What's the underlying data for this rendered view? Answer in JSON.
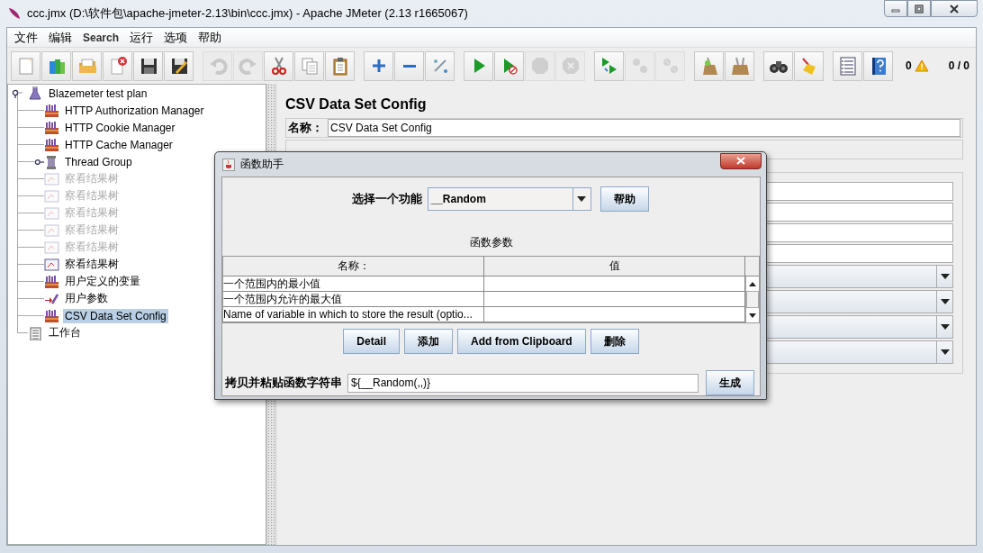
{
  "window": {
    "title": "ccc.jmx (D:\\软件包\\apache-jmeter-2.13\\bin\\ccc.jmx) - Apache JMeter (2.13 r1665067)"
  },
  "menu": [
    "文件",
    "编辑",
    "Search",
    "运行",
    "选项",
    "帮助"
  ],
  "toolbar": {
    "groups": [
      [
        {
          "kind": "new",
          "disabled": false
        },
        {
          "kind": "templates",
          "disabled": false
        },
        {
          "kind": "open",
          "disabled": false
        },
        {
          "kind": "close",
          "disabled": false
        },
        {
          "kind": "save",
          "disabled": false
        },
        {
          "kind": "save-as",
          "disabled": false
        }
      ],
      [
        {
          "kind": "undo",
          "disabled": true
        },
        {
          "kind": "redo",
          "disabled": true
        },
        {
          "kind": "cut",
          "disabled": false
        },
        {
          "kind": "copy",
          "disabled": false
        },
        {
          "kind": "paste",
          "disabled": false
        }
      ],
      [
        {
          "kind": "expand",
          "disabled": false
        },
        {
          "kind": "collapse",
          "disabled": false
        },
        {
          "kind": "toggle",
          "disabled": false
        }
      ],
      [
        {
          "kind": "start",
          "disabled": false
        },
        {
          "kind": "start-no-pause",
          "disabled": false
        },
        {
          "kind": "stop",
          "disabled": true
        },
        {
          "kind": "shutdown",
          "disabled": true
        }
      ],
      [
        {
          "kind": "remote-start",
          "disabled": false
        },
        {
          "kind": "remote-stop",
          "disabled": true
        },
        {
          "kind": "remote-shutdown",
          "disabled": true
        }
      ],
      [
        {
          "kind": "clear",
          "disabled": false
        },
        {
          "kind": "clear-all",
          "disabled": false
        }
      ],
      [
        {
          "kind": "search",
          "disabled": false
        },
        {
          "kind": "reset-search",
          "disabled": false
        }
      ],
      [
        {
          "kind": "function",
          "disabled": false
        },
        {
          "kind": "help",
          "disabled": false
        }
      ]
    ],
    "error_count": "0",
    "thread_count": "0 / 0"
  },
  "tree": [
    {
      "label": "Blazemeter test plan",
      "kind": "test-plan",
      "expanded": true,
      "disabled": false,
      "selected": false,
      "children": [
        {
          "label": "HTTP Authorization Manager",
          "kind": "config",
          "disabled": false,
          "selected": false
        },
        {
          "label": "HTTP Cookie Manager",
          "kind": "config",
          "disabled": false,
          "selected": false
        },
        {
          "label": "HTTP Cache Manager",
          "kind": "config",
          "disabled": false,
          "selected": false
        },
        {
          "label": "Thread Group",
          "kind": "thread-group",
          "expanded": false,
          "disabled": false,
          "selected": false
        },
        {
          "label": "察看结果树",
          "kind": "listener",
          "disabled": true,
          "selected": false
        },
        {
          "label": "察看结果树",
          "kind": "listener",
          "disabled": true,
          "selected": false
        },
        {
          "label": "察看结果树",
          "kind": "listener",
          "disabled": true,
          "selected": false
        },
        {
          "label": "察看结果树",
          "kind": "listener",
          "disabled": true,
          "selected": false
        },
        {
          "label": "察看结果树",
          "kind": "listener",
          "disabled": true,
          "selected": false
        },
        {
          "label": "察看结果树",
          "kind": "listener",
          "disabled": false,
          "selected": false
        },
        {
          "label": "用户定义的变量",
          "kind": "config",
          "disabled": false,
          "selected": false
        },
        {
          "label": "用户参数",
          "kind": "preprocessor",
          "disabled": false,
          "selected": false
        },
        {
          "label": "CSV Data Set Config",
          "kind": "config",
          "disabled": false,
          "selected": true
        }
      ]
    },
    {
      "label": "工作台",
      "kind": "workbench",
      "disabled": false,
      "selected": false
    }
  ],
  "editor": {
    "title": "CSV Data Set Config",
    "name_label": "名称：",
    "name_value": "CSV Data Set Config",
    "settings_fields": [
      {
        "kind": "text"
      },
      {
        "kind": "text"
      },
      {
        "kind": "text"
      },
      {
        "kind": "text"
      },
      {
        "kind": "dropdown"
      },
      {
        "kind": "dropdown"
      },
      {
        "kind": "dropdown"
      },
      {
        "kind": "dropdown"
      }
    ]
  },
  "dialog": {
    "title": "函数助手",
    "function_label": "选择一个功能",
    "function_value": "__Random",
    "help_button": "帮助",
    "params_title": "函数参数",
    "columns": [
      "名称：",
      "值"
    ],
    "rows": [
      {
        "name": "一个范围内的最小值"
      },
      {
        "name": "一个范围内允许的最大值"
      },
      {
        "name": "Name of variable in which to store the result (optio..."
      }
    ],
    "buttons": [
      "Detail",
      "添加",
      "Add from Clipboard",
      "删除"
    ],
    "string_label": "拷贝并粘贴函数字符串",
    "string_value": "${__Random(,,)}",
    "generate_button": "生成"
  }
}
